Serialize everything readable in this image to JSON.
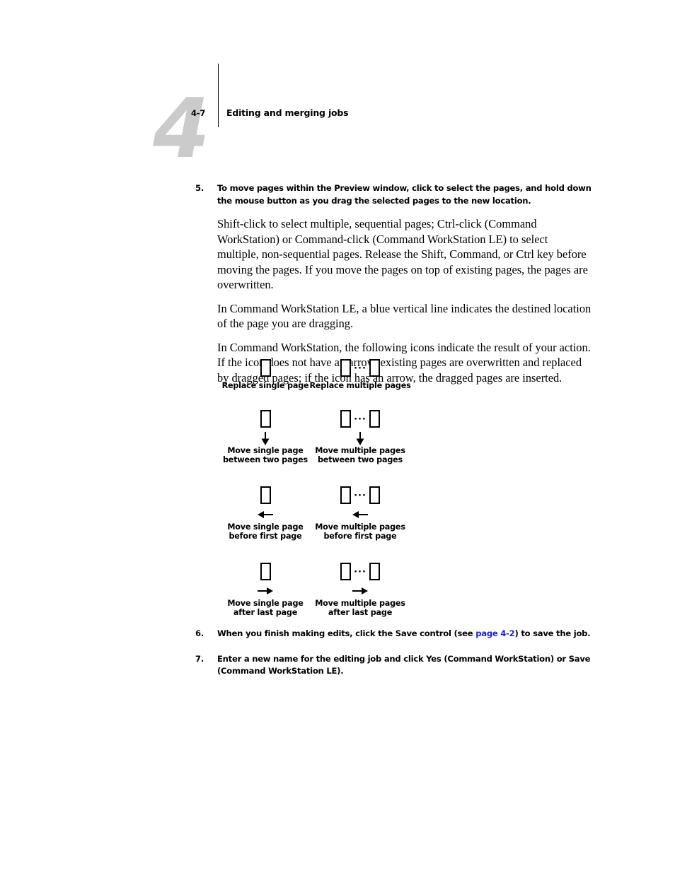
{
  "header": {
    "chapter_number": "4",
    "folio": "4-7",
    "title": "Editing and merging jobs"
  },
  "colors": {
    "link": "#1b1bdf",
    "chapter_number": "#cbcbcb",
    "text": "#000000",
    "page_background": "#ffffff"
  },
  "steps": {
    "step5": {
      "number": "5.",
      "text": "To move pages within the Preview window, click to select the pages, and hold down the mouse button as you drag the selected pages to the new location."
    },
    "step6": {
      "number": "6.",
      "text_before_link": "When you finish making edits, click the Save control (see ",
      "link_label": "page 4-2",
      "text_after_link": ") to save the job."
    },
    "step7": {
      "number": "7.",
      "text": "Enter a new name for the editing job and click Yes (Command WorkStation) or Save (Command WorkStation LE)."
    }
  },
  "paragraphs": [
    "Shift-click to select multiple, sequential pages; Ctrl-click (Command WorkStation) or Command-click (Command WorkStation LE) to select multiple, non-sequential pages. Release the Shift, Command, or Ctrl key before moving the pages. If you move the pages on top of existing pages, the pages are overwritten.",
    "In Command WorkStation LE, a blue vertical line indicates the destined location of the page you are dragging.",
    "In Command WorkStation, the following icons indicate the result of your action. If the icon does not have an arrow, existing pages are overwritten and replaced by dragged pages; if the icon has an arrow, the dragged pages are inserted."
  ],
  "icon_figure": {
    "ellipsis": "···",
    "rows": [
      {
        "arrow": "none",
        "single": {
          "caption": "Replace single page",
          "icon": "page-rect-icon"
        },
        "multiple": {
          "caption": "Replace multiple pages",
          "icon": "page-rect-multiple-icon"
        }
      },
      {
        "arrow": "down",
        "single": {
          "caption": "Move single page\nbetween two pages",
          "icon": "page-rect-arrow-down-icon"
        },
        "multiple": {
          "caption": "Move multiple pages\nbetween two pages",
          "icon": "page-rect-multiple-arrow-down-icon"
        }
      },
      {
        "arrow": "left",
        "single": {
          "caption": "Move single page\nbefore first page",
          "icon": "page-rect-arrow-left-icon"
        },
        "multiple": {
          "caption": "Move multiple pages\nbefore first page",
          "icon": "page-rect-multiple-arrow-left-icon"
        }
      },
      {
        "arrow": "right",
        "single": {
          "caption": "Move single page\nafter last page",
          "icon": "page-rect-arrow-right-icon"
        },
        "multiple": {
          "caption": "Move multiple pages\nafter last page",
          "icon": "page-rect-multiple-arrow-right-icon"
        }
      }
    ]
  }
}
